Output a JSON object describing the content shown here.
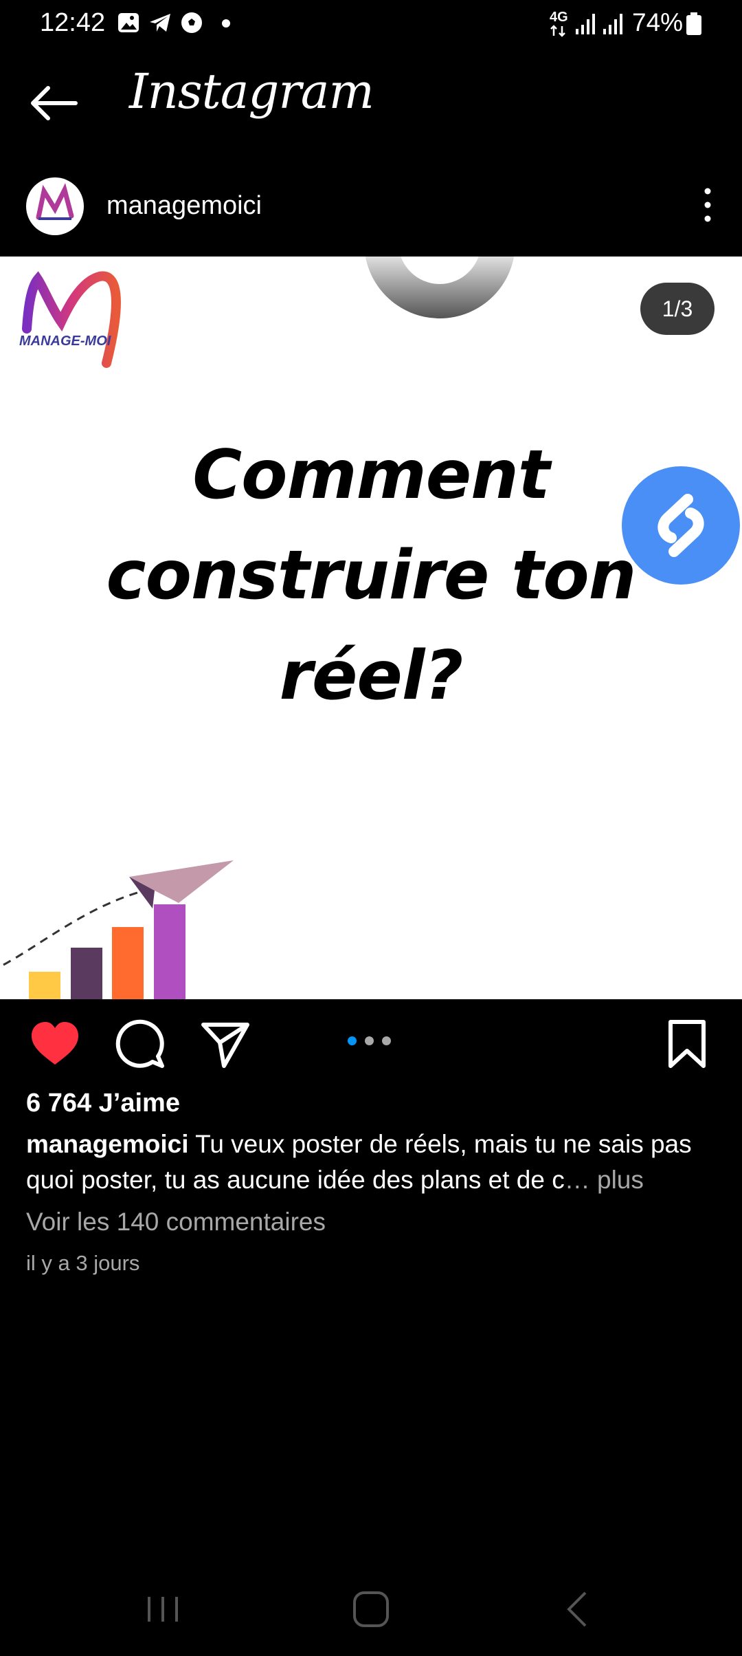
{
  "status_bar": {
    "time": "12:42",
    "network": "4G",
    "battery": "74%",
    "icons": [
      "gallery-icon",
      "telegram-icon",
      "soccer-ball-icon",
      "dot-icon",
      "signal-icon",
      "signal-icon",
      "battery-icon"
    ]
  },
  "header": {
    "back_icon": "arrow-left-icon",
    "app_name": "Instagram"
  },
  "post": {
    "username": "managemoici",
    "slide_counter": "1/3",
    "image": {
      "logo_text": "MANAGE-MOI",
      "headline": [
        "Comment",
        "construire ton",
        "réel?"
      ]
    },
    "likes": "6 764 J’aime",
    "caption_user": "managemoici",
    "caption_text": " Tu veux poster de réels, mais tu ne sais pas quoi poster, tu as aucune idée des plans et de c",
    "caption_more": "… plus",
    "comments_link": "Voir les 140 commentaires",
    "time_ago": "il y a 3 jours",
    "carousel": {
      "total": 3,
      "active": 1
    }
  },
  "colors": {
    "like_red": "#ff3040",
    "carousel_active": "#0095f6",
    "shazam_blue": "#4a8ff5",
    "bar_colors": [
      "#ffc845",
      "#5a3a5e",
      "#ff6a2f",
      "#b04fc0"
    ]
  }
}
